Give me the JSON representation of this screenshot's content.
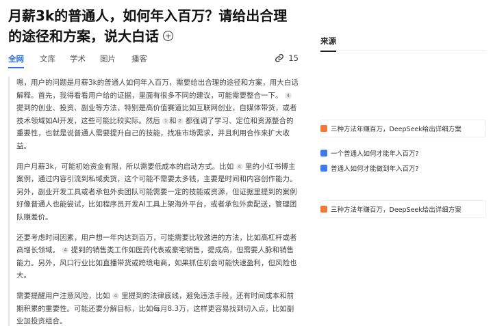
{
  "question": {
    "title": "月薪3k的普通人，如何年入百万？请给出合理的途径和方案，说大白话"
  },
  "tabs": [
    {
      "label": "全网",
      "active": true
    },
    {
      "label": "文库",
      "active": false
    },
    {
      "label": "学术",
      "active": false
    },
    {
      "label": "图片",
      "active": false
    },
    {
      "label": "播客",
      "active": false
    }
  ],
  "link_count": "15",
  "answer": {
    "p1": [
      "嗯，用户的问题是月薪3k的普通人如何年入百万，需要给出合理的途径和方案，用大白话解释。首先，我得看看用户给的证据，里面有很多不同的建议，可能需要整合一下。",
      "4",
      "提到的创业、投资、副业等方法，特别是高价值赛道比如互联网创业，自媒体带货，或者技术领域如AI开发，这些可能比较实际。然后",
      "1",
      "和",
      "2",
      "都强调了学习、定位和资源整合的重要性，也就是说普通人需要提升自己的技能，找准市场需求，并且利用合作来扩大收益。"
    ],
    "p2": [
      "用户月薪3k，可能初始资金有限，所以需要低成本的启动方式。比如",
      "4",
      "里的小红书博主案例，通过内容引流到私域卖货，这个可能不需要太多钱，主要是时间和内容创作能力。另外，副业开发工具或者承包外卖团队可能需要一定的技能或资源，但证据里提到的案例好像普通人也能尝试，比如程序员开发AI工具上架海外平台，或者承包外卖配送，管理团队赚差价。"
    ],
    "p3": [
      "还要考虑时间因素，用户想一年内达到百万，可能需要比较激进的方法，比如高杠杆或者高增长领域。",
      "4",
      "提到的销售类工作如医药代表或豪宅销售，提成高，但需要人脉和销售能力。另外，风口行业比如直播带货或跨境电商，如果抓住机会可能快速盈利，但风险也大。"
    ],
    "p4": [
      "需要提醒用户注意风险，比如",
      "4",
      "里提到的法律底线，避免违法手段，还有时间成本和前期积累的重要性。可能还要分解目标，比如每月8.3万，这样更容易找到切入点，比如副业加投资组合。"
    ]
  },
  "sources": {
    "title": "来源",
    "items": [
      {
        "label": "三种方法年赚百万，DeepSeek给出详细方案",
        "icon": "orange-doc-icon"
      },
      {
        "label": "一个普通人如何才能年入百万?",
        "icon": "blue-app-icon"
      },
      {
        "label": "普通人如何才能做到年入百万?",
        "icon": "blue-app-icon"
      },
      {
        "label": "三种方法年赚百万，DeepSeek给出详细方案",
        "icon": "orange-doc-icon"
      }
    ]
  },
  "colors": {
    "accent": "#2c6df1",
    "source_orange": "#f0793a",
    "source_blue": "#3a7bf0"
  }
}
